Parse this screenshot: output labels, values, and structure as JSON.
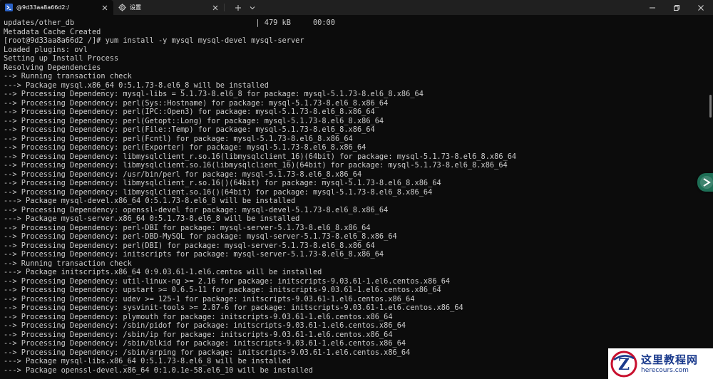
{
  "window": {
    "tabs": [
      {
        "label": "@9d33aa8a66d2:/",
        "icon": "powershell-icon",
        "active": true
      },
      {
        "label": "设置",
        "icon": "gear-icon",
        "active": false
      }
    ],
    "controls": [
      "minimize-icon",
      "restore-icon",
      "close-icon"
    ],
    "accent_color": "#0c0c0c",
    "titlebar_color": "#202020",
    "text_color": "#cccccc"
  },
  "terminal": {
    "lines": [
      "updates/other_db                                         | 479 kB     00:00",
      "Metadata Cache Created",
      "[root@9d33aa8a66d2 /]# yum install -y mysql mysql-devel mysql-server",
      "Loaded plugins: ovl",
      "Setting up Install Process",
      "Resolving Dependencies",
      "--> Running transaction check",
      "---> Package mysql.x86_64 0:5.1.73-8.el6_8 will be installed",
      "--> Processing Dependency: mysql-libs = 5.1.73-8.el6_8 for package: mysql-5.1.73-8.el6_8.x86_64",
      "--> Processing Dependency: perl(Sys::Hostname) for package: mysql-5.1.73-8.el6_8.x86_64",
      "--> Processing Dependency: perl(IPC::Open3) for package: mysql-5.1.73-8.el6_8.x86_64",
      "--> Processing Dependency: perl(Getopt::Long) for package: mysql-5.1.73-8.el6_8.x86_64",
      "--> Processing Dependency: perl(File::Temp) for package: mysql-5.1.73-8.el6_8.x86_64",
      "--> Processing Dependency: perl(Fcntl) for package: mysql-5.1.73-8.el6_8.x86_64",
      "--> Processing Dependency: perl(Exporter) for package: mysql-5.1.73-8.el6_8.x86_64",
      "--> Processing Dependency: libmysqlclient_r.so.16(libmysqlclient_16)(64bit) for package: mysql-5.1.73-8.el6_8.x86_64",
      "--> Processing Dependency: libmysqlclient.so.16(libmysqlclient_16)(64bit) for package: mysql-5.1.73-8.el6_8.x86_64",
      "--> Processing Dependency: /usr/bin/perl for package: mysql-5.1.73-8.el6_8.x86_64",
      "--> Processing Dependency: libmysqlclient_r.so.16()(64bit) for package: mysql-5.1.73-8.el6_8.x86_64",
      "--> Processing Dependency: libmysqlclient.so.16()(64bit) for package: mysql-5.1.73-8.el6_8.x86_64",
      "---> Package mysql-devel.x86_64 0:5.1.73-8.el6_8 will be installed",
      "--> Processing Dependency: openssl-devel for package: mysql-devel-5.1.73-8.el6_8.x86_64",
      "---> Package mysql-server.x86_64 0:5.1.73-8.el6_8 will be installed",
      "--> Processing Dependency: perl-DBI for package: mysql-server-5.1.73-8.el6_8.x86_64",
      "--> Processing Dependency: perl-DBD-MySQL for package: mysql-server-5.1.73-8.el6_8.x86_64",
      "--> Processing Dependency: perl(DBI) for package: mysql-server-5.1.73-8.el6_8.x86_64",
      "--> Processing Dependency: initscripts for package: mysql-server-5.1.73-8.el6_8.x86_64",
      "--> Running transaction check",
      "---> Package initscripts.x86_64 0:9.03.61-1.el6.centos will be installed",
      "--> Processing Dependency: util-linux-ng >= 2.16 for package: initscripts-9.03.61-1.el6.centos.x86_64",
      "--> Processing Dependency: upstart >= 0.6.5-11 for package: initscripts-9.03.61-1.el6.centos.x86_64",
      "--> Processing Dependency: udev >= 125-1 for package: initscripts-9.03.61-1.el6.centos.x86_64",
      "--> Processing Dependency: sysvinit-tools >= 2.87-6 for package: initscripts-9.03.61-1.el6.centos.x86_64",
      "--> Processing Dependency: plymouth for package: initscripts-9.03.61-1.el6.centos.x86_64",
      "--> Processing Dependency: /sbin/pidof for package: initscripts-9.03.61-1.el6.centos.x86_64",
      "--> Processing Dependency: /sbin/ip for package: initscripts-9.03.61-1.el6.centos.x86_64",
      "--> Processing Dependency: /sbin/blkid for package: initscripts-9.03.61-1.el6.centos.x86_64",
      "--> Processing Dependency: /sbin/arping for package: initscripts-9.03.61-1.el6.centos.x86_64",
      "---> Package mysql-libs.x86_64 0:5.1.73-8.el6_8 will be installed",
      "---> Package openssl-devel.x86_64 0:1.0.1e-58.el6_10 will be installed"
    ]
  },
  "watermark": {
    "title": "这里教程网",
    "subtitle": "herecours.com",
    "logo_letter": "Z",
    "color": "#1a3a8c"
  }
}
